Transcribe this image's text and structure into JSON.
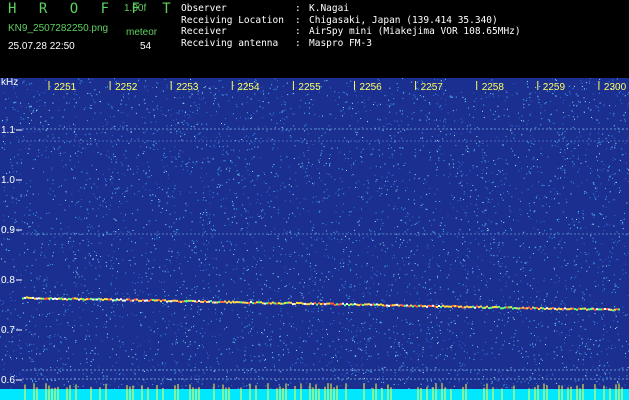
{
  "header": {
    "app_name": "H R O F F T",
    "version": "1.00f",
    "filename": "KN9_2507282250.png",
    "meteor_label": "meteor",
    "datetime": "25.07.28 22:50",
    "meteor_count": "54",
    "meta": [
      {
        "label": "Observer",
        "sep": ":",
        "value": "K.Nagai"
      },
      {
        "label": "Receiving Location",
        "sep": ":",
        "value": "Chigasaki, Japan (139.414 35.340)"
      },
      {
        "label": "Receiver",
        "sep": ":",
        "value": "AirSpy mini (Miakejima VOR 108.65MHz)"
      },
      {
        "label": "Receiving antenna",
        "sep": ":",
        "value": "Maspro FM-3"
      }
    ]
  },
  "plot": {
    "y_unit": "kHz",
    "y_ticks": [
      "1.1",
      "1.0",
      "0.9",
      "0.8",
      "0.7",
      "0.6"
    ],
    "x_ticks": [
      "2251",
      "2252",
      "2253",
      "2254",
      "2255",
      "2256",
      "2257",
      "2258",
      "2259",
      "2300"
    ],
    "colors": {
      "background": "#1a2f8f",
      "noise": "#35a8ff",
      "tick_text": "#ffff60",
      "axis_text": "#ffffff",
      "bottom_bar": "#00e8ff"
    }
  }
}
